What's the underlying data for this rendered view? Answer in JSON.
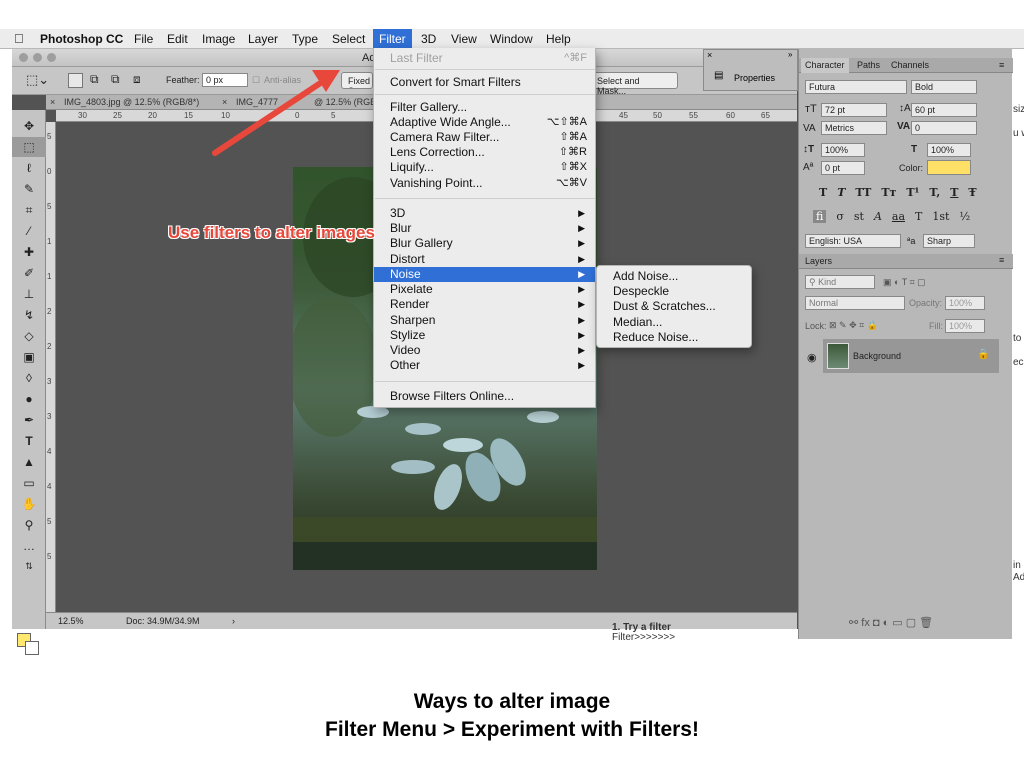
{
  "menubar": {
    "app_name": "Photoshop CC",
    "items": [
      "File",
      "Edit",
      "Image",
      "Layer",
      "Type",
      "Select",
      "Filter",
      "3D",
      "View",
      "Window",
      "Help"
    ],
    "active": "Filter"
  },
  "window": {
    "title_fragment": "Ad"
  },
  "options_bar": {
    "feather_label": "Feather:",
    "feather_value": "0 px",
    "antialias_label": "Anti-alias",
    "style_fragment": "Fixed S",
    "select_mask_label": "Select and Mask..."
  },
  "doc_tabs": [
    "IMG_4803.jpg @ 12.5% (RGB/8*)",
    "IMG_4777",
    "@ 12.5% (RGB/8"
  ],
  "ruler_h_ticks": [
    "30",
    "25",
    "20",
    "15",
    "10",
    "0",
    "5",
    "45",
    "50",
    "55",
    "60",
    "65"
  ],
  "ruler_v_ticks": [
    "5",
    "0",
    "5",
    "1",
    "1",
    "2",
    "2",
    "3",
    "3",
    "4",
    "4",
    "5",
    "5"
  ],
  "status": {
    "zoom": "12.5%",
    "doc": "Doc: 34.9M/34.9M"
  },
  "filter_menu": {
    "items": [
      {
        "label": "Last Filter",
        "shortcut": "^⌘F",
        "disabled": true
      },
      {
        "label": "Convert for Smart Filters"
      },
      {
        "label": "Filter Gallery..."
      },
      {
        "label": "Adaptive Wide Angle...",
        "shortcut": "⌥⇧⌘A"
      },
      {
        "label": "Camera Raw Filter...",
        "shortcut": "⇧⌘A"
      },
      {
        "label": "Lens Correction...",
        "shortcut": "⇧⌘R"
      },
      {
        "label": "Liquify...",
        "shortcut": "⇧⌘X"
      },
      {
        "label": "Vanishing Point...",
        "shortcut": "⌥⌘V"
      },
      {
        "label": "3D",
        "submenu": true
      },
      {
        "label": "Blur",
        "submenu": true
      },
      {
        "label": "Blur Gallery",
        "submenu": true
      },
      {
        "label": "Distort",
        "submenu": true
      },
      {
        "label": "Noise",
        "submenu": true,
        "highlighted": true
      },
      {
        "label": "Pixelate",
        "submenu": true
      },
      {
        "label": "Render",
        "submenu": true
      },
      {
        "label": "Sharpen",
        "submenu": true
      },
      {
        "label": "Stylize",
        "submenu": true
      },
      {
        "label": "Video",
        "submenu": true
      },
      {
        "label": "Other",
        "submenu": true
      },
      {
        "label": "Browse Filters Online..."
      }
    ]
  },
  "noise_submenu": [
    "Add Noise...",
    "Despeckle",
    "Dust & Scratches...",
    "Median...",
    "Reduce Noise..."
  ],
  "annotation": "Use filters to alter images",
  "properties_panel": {
    "label": "Properties"
  },
  "character_panel": {
    "tabs": [
      "Character",
      "Paths",
      "Channels"
    ],
    "font": "Futura",
    "style": "Bold",
    "size": "72 pt",
    "leading": "60 pt",
    "kerning": "Metrics",
    "tracking": "0",
    "vscale": "100%",
    "hscale": "100%",
    "baseline": "0 pt",
    "color_label": "Color:",
    "color_value": "#ffe066",
    "glyph_row1": [
      "T",
      "T",
      "TT",
      "Tт",
      "T¹",
      "T,",
      "T",
      "Ŧ"
    ],
    "glyph_row2": [
      "fi",
      "σ",
      "st",
      "A",
      "aa",
      "T",
      "1st",
      "½"
    ],
    "language": "English: USA",
    "aa_label": "ªa",
    "aa_value": "Sharp"
  },
  "layers_panel": {
    "title": "Layers",
    "kind_label": "Kind",
    "blend_mode": "Normal",
    "opacity_label": "Opacity:",
    "opacity_value": "100%",
    "lock_label": "Lock:",
    "fill_label": "Fill:",
    "fill_value": "100%",
    "layer_name": "Background"
  },
  "side_fragments": [
    "siz",
    "u w",
    "to",
    "ec",
    "in",
    "Adj"
  ],
  "bottom_fragments": [
    "1. Try a filter",
    "Filter>>>>>>>"
  ],
  "caption": {
    "line1": "Ways to alter image",
    "line2": "Filter Menu > Experiment with Filters!"
  }
}
